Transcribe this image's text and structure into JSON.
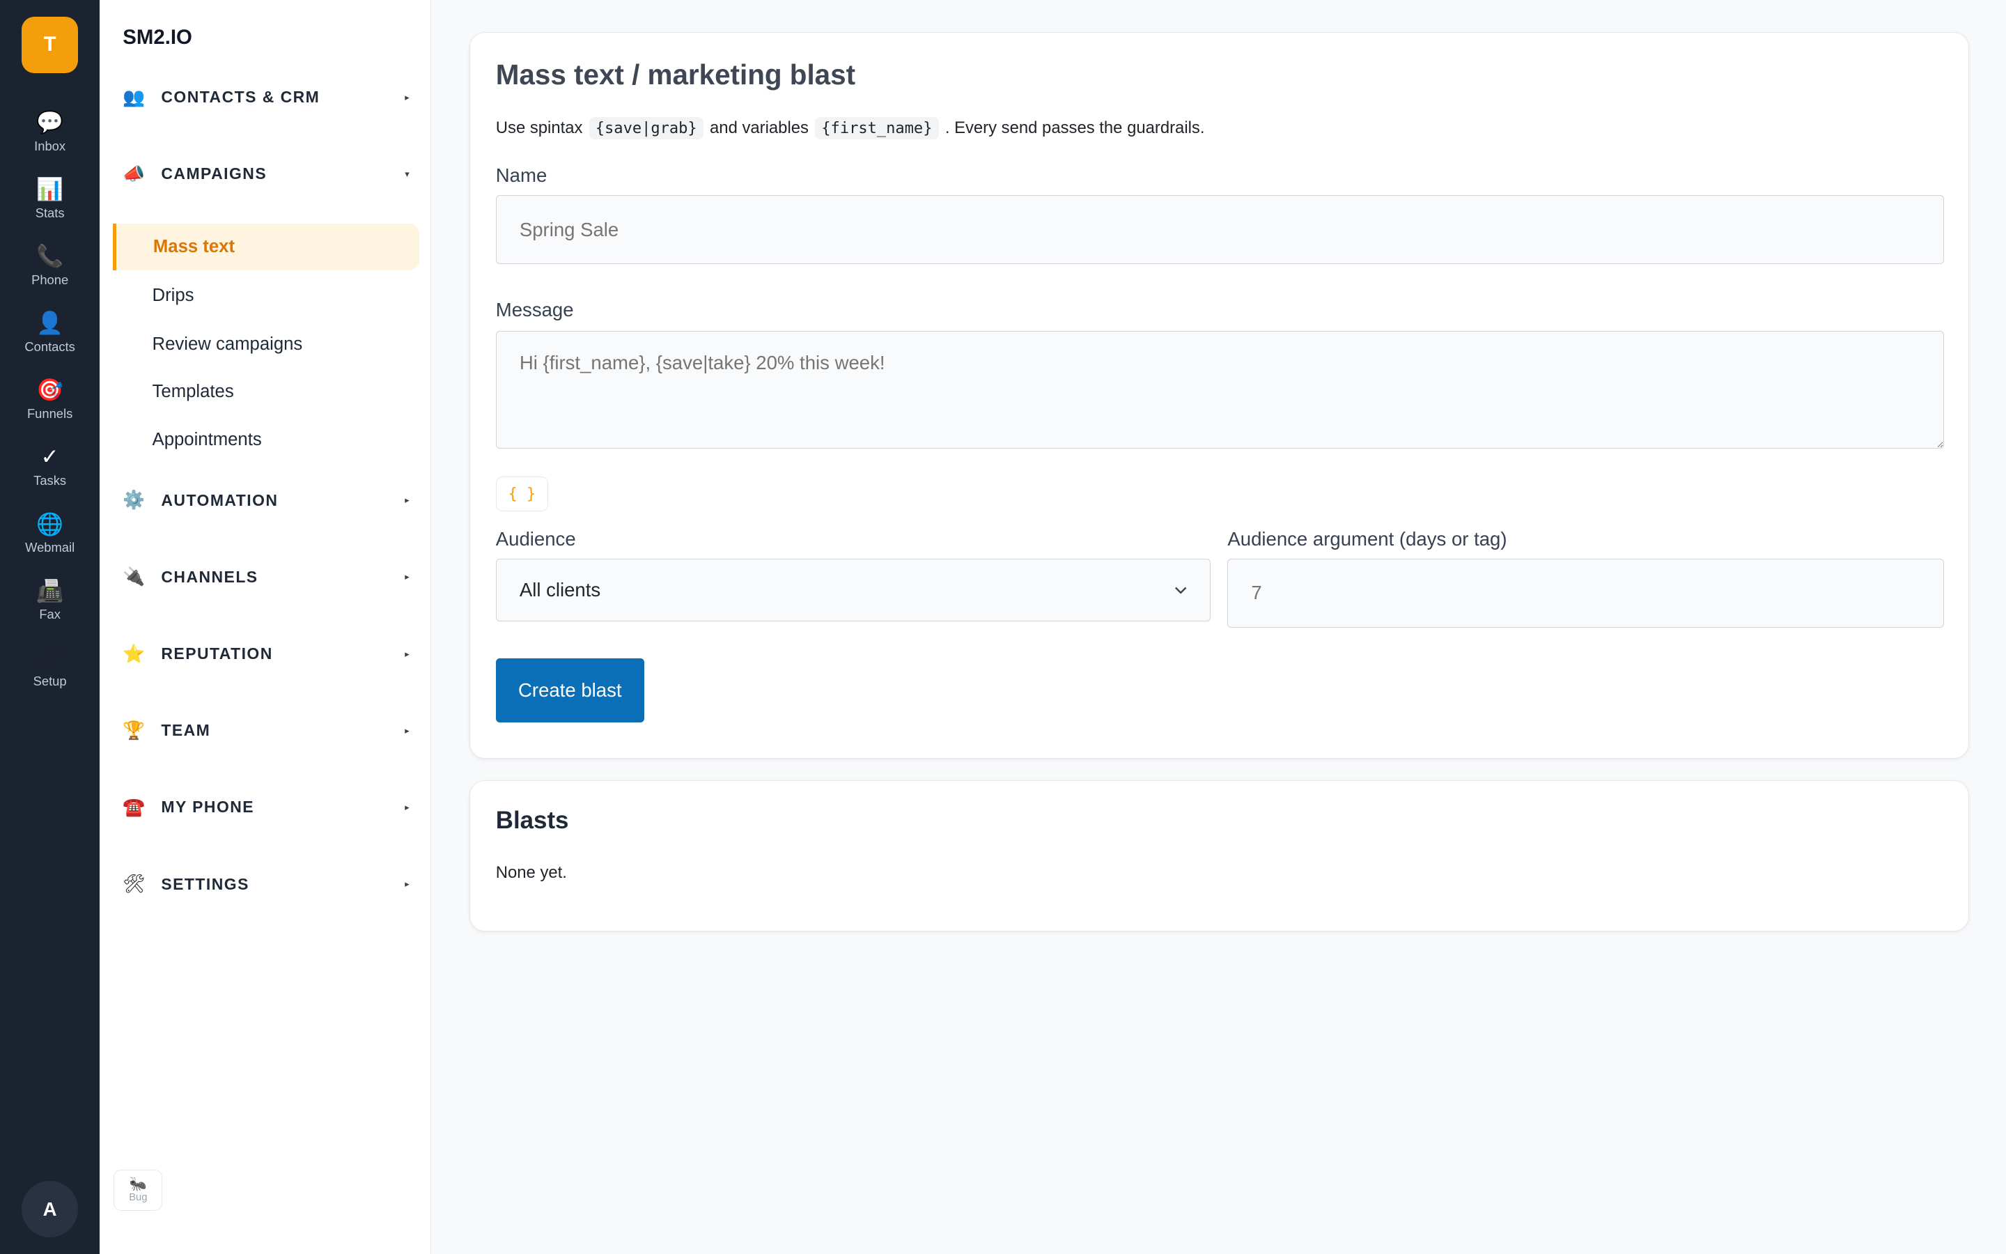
{
  "rail": {
    "logo": "T",
    "items": [
      {
        "icon": "💬",
        "label": "Inbox"
      },
      {
        "icon": "📊",
        "label": "Stats"
      },
      {
        "icon": "📞",
        "label": "Phone"
      },
      {
        "icon": "👤",
        "label": "Contacts"
      },
      {
        "icon": "🎯",
        "label": "Funnels"
      },
      {
        "icon": "✓",
        "label": "Tasks"
      },
      {
        "icon": "🌐",
        "label": "Webmail"
      },
      {
        "icon": "📠",
        "label": "Fax"
      },
      {
        "icon": "🛠",
        "label": "Setup"
      }
    ],
    "avatar": "A"
  },
  "sidebar": {
    "brand": "SM2.IO",
    "sections": [
      {
        "icon": "👥",
        "label": "CONTACTS & CRM",
        "caret": "▸"
      },
      {
        "icon": "📣",
        "label": "CAMPAIGNS",
        "caret": "▾"
      },
      {
        "icon": "⚙️",
        "label": "AUTOMATION",
        "caret": "▸"
      },
      {
        "icon": "🔌",
        "label": "CHANNELS",
        "caret": "▸"
      },
      {
        "icon": "⭐",
        "label": "REPUTATION",
        "caret": "▸"
      },
      {
        "icon": "🏆",
        "label": "TEAM",
        "caret": "▸"
      },
      {
        "icon": "☎️",
        "label": "MY PHONE",
        "caret": "▸"
      },
      {
        "icon": "🛠",
        "label": "SETTINGS",
        "caret": "▸"
      }
    ],
    "campaign_items": [
      {
        "label": "Mass text"
      },
      {
        "label": "Drips"
      },
      {
        "label": "Review campaigns"
      },
      {
        "label": "Templates"
      },
      {
        "label": "Appointments"
      }
    ],
    "bug": {
      "icon": "🐜",
      "label": "Bug"
    }
  },
  "form": {
    "title": "Mass text / marketing blast",
    "desc_prefix": "Use spintax",
    "desc_code1": "{save|grab}",
    "desc_middle": "and variables",
    "desc_code2": "{first_name}",
    "desc_suffix": ". Every send passes the guardrails.",
    "name_label": "Name",
    "name_placeholder": "Spring Sale",
    "message_label": "Message",
    "message_placeholder": "Hi {first_name}, {save|take} 20% this week!",
    "spintax_button": "{ }",
    "audience_label": "Audience",
    "audience_value": "All clients",
    "audience_arg_label": "Audience argument (days or tag)",
    "audience_arg_placeholder": "7",
    "submit_label": "Create blast"
  },
  "blasts": {
    "title": "Blasts",
    "empty": "None yet."
  },
  "colors": {
    "accent": "#f59e0b",
    "primary": "#0b6fb8",
    "rail_bg": "#1b2230"
  }
}
